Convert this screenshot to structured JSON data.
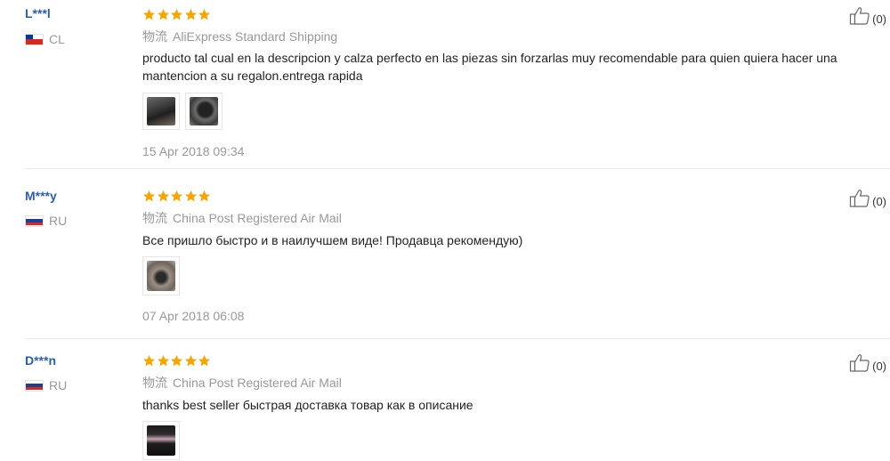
{
  "reviews": [
    {
      "username": "L***l",
      "country_code": "CL",
      "flag_icon": "chile-flag-icon",
      "rating": 5,
      "shipping_prefix": "物流",
      "shipping_method": "AliExpress Standard Shipping",
      "text": "producto tal cual en la descripcion y calza perfecto en las piezas sin forzarlas muy recomendable para quien quiera hacer una mantencion a su regalon.entrega rapida",
      "photos": [
        "review-photo-1",
        "review-photo-2"
      ],
      "date": "15 Apr 2018 09:34",
      "helpful_count": "(0)"
    },
    {
      "username": "M***y",
      "country_code": "RU",
      "flag_icon": "russia-flag-icon",
      "rating": 5,
      "shipping_prefix": "物流",
      "shipping_method": "China Post Registered Air Mail",
      "text": "Все пришло быстро и в наилучшем виде! Продавца рекомендую)",
      "photos": [
        "review-photo-1"
      ],
      "date": "07 Apr 2018 06:08",
      "helpful_count": "(0)"
    },
    {
      "username": "D***n",
      "country_code": "RU",
      "flag_icon": "russia-flag-icon",
      "rating": 5,
      "shipping_prefix": "物流",
      "shipping_method": "China Post Registered Air Mail",
      "text": "thanks best seller быстрая доставка товар как в описание",
      "photos": [
        "review-photo-1"
      ],
      "date": "",
      "helpful_count": "(0)"
    }
  ],
  "colors": {
    "username": "#2b5fa9",
    "star": "#f7a500",
    "meta_text": "#999999",
    "body_text": "#222222"
  }
}
